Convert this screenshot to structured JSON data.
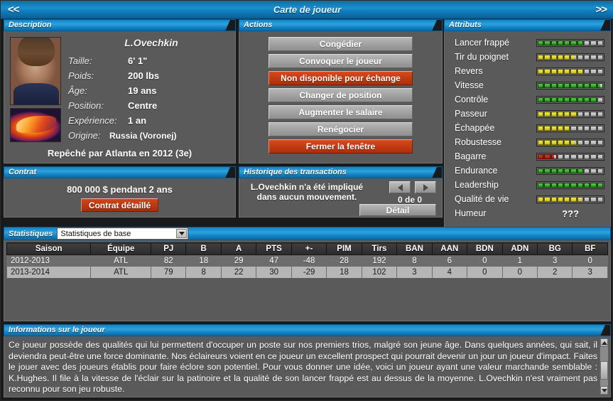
{
  "window": {
    "title": "Carte de joueur",
    "nav_prev": "<<",
    "nav_next": ">>"
  },
  "description": {
    "header": "Description",
    "player_name": "L.Ovechkin",
    "fields": [
      {
        "label": "Taille:",
        "value": "6' 1\""
      },
      {
        "label": "Poids:",
        "value": "200 lbs"
      },
      {
        "label": "Âge:",
        "value": "19 ans"
      },
      {
        "label": "Position:",
        "value": "Centre"
      },
      {
        "label": "Expérience:",
        "value": "1 an"
      },
      {
        "label": "Origine:",
        "value": "Russia (Voronej)"
      }
    ],
    "draft_note": "Repêché par Atlanta en 2012 (3e)"
  },
  "actions": {
    "header": "Actions",
    "buttons": [
      {
        "label": "Congédier",
        "style": "gray"
      },
      {
        "label": "Convoquer le joueur",
        "style": "gray"
      },
      {
        "label": "Non disponible pour échange",
        "style": "red"
      },
      {
        "label": "Changer de position",
        "style": "gray"
      },
      {
        "label": "Augmenter le salaire",
        "style": "gray"
      },
      {
        "label": "Renégocier",
        "style": "gray"
      },
      {
        "label": "Fermer la fenêtre",
        "style": "red"
      }
    ]
  },
  "attributes": {
    "header": "Attributs",
    "max_segments": 10,
    "items": [
      {
        "label": "Lancer frappé",
        "value": 7,
        "color": "green"
      },
      {
        "label": "Tir du poignet",
        "value": 5.5,
        "color": "yellow"
      },
      {
        "label": "Revers",
        "value": 7,
        "color": "yellow"
      },
      {
        "label": "Vitesse",
        "value": 9.5,
        "color": "green"
      },
      {
        "label": "Contrôle",
        "value": 9,
        "color": "green"
      },
      {
        "label": "Passeur",
        "value": 6,
        "color": "yellow"
      },
      {
        "label": "Échappée",
        "value": 5,
        "color": "yellow"
      },
      {
        "label": "Robustesse",
        "value": 5.5,
        "color": "yellow"
      },
      {
        "label": "Bagarre",
        "value": 2.5,
        "color": "red"
      },
      {
        "label": "Endurance",
        "value": 7,
        "color": "green"
      },
      {
        "label": "Leadership",
        "value": 10,
        "color": "green"
      },
      {
        "label": "Qualité de vie",
        "value": 6.5,
        "color": "yellow"
      }
    ],
    "mood": {
      "label": "Humeur",
      "value": "???"
    }
  },
  "contract": {
    "header": "Contrat",
    "summary": "800 000 $ pendant 2 ans",
    "detail_button": "Contrat détaillé"
  },
  "transactions": {
    "header": "Historique des transactions",
    "message": "L.Ovechkin n'a été impliqué dans aucun mouvement.",
    "counter": "0 de 0",
    "detail_button": "Détail",
    "prev_icon": "triangle-left-icon",
    "next_icon": "triangle-right-icon"
  },
  "statistics": {
    "header": "Statistiques",
    "selected_view": "Statistiques de base",
    "columns": [
      "Saison",
      "Équipe",
      "PJ",
      "B",
      "A",
      "PTS",
      "+-",
      "PIM",
      "Tirs",
      "BAN",
      "AAN",
      "BDN",
      "ADN",
      "BG",
      "BF"
    ],
    "rows": [
      [
        "2012-2013",
        "ATL",
        "82",
        "18",
        "29",
        "47",
        "-48",
        "28",
        "192",
        "8",
        "6",
        "0",
        "1",
        "3",
        "0"
      ],
      [
        "2013-2014",
        "ATL",
        "79",
        "8",
        "22",
        "30",
        "-29",
        "18",
        "102",
        "3",
        "4",
        "0",
        "0",
        "2",
        "3"
      ]
    ]
  },
  "info": {
    "header": "Informations sur le joueur",
    "text": "Ce joueur possède des qualités qui lui permettent d'occuper un poste sur nos premiers trios, malgré son jeune âge. Dans quelques années, qui sait, il deviendra peut-être une force dominante. Nos éclaireurs voient en ce joueur un excellent prospect qui pourrait devenir un jour un joueur d'impact. Faites le jouer avec des joueurs établis pour faire éclore son potentiel.  Pour vous donner une idée, voici un joueur ayant une valeur marchande semblable : K.Hughes. Il file à la vitesse de l'éclair sur la patinoire et la qualité de son lancer frappé est au dessus de la moyenne. L.Ovechkin n'est vraiment pas reconnu pour son jeu robuste."
  },
  "colors": {
    "accent_blue": "#1a8fd0",
    "panel_gray": "#5a5a5a",
    "red_button": "#c13c12",
    "green_bar": "#2f9e22",
    "yellow_bar": "#d9cf18",
    "red_bar": "#b81b08"
  }
}
